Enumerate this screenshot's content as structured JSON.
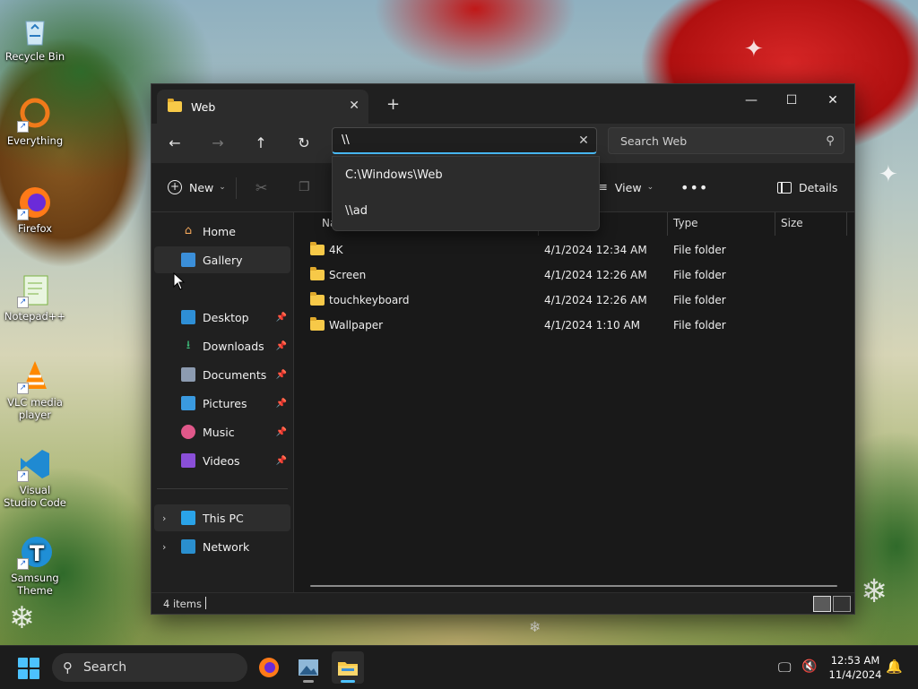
{
  "desktop": {
    "icons": [
      {
        "label": "Recycle Bin",
        "icon": "recycle-bin-icon"
      },
      {
        "label": "Everything",
        "icon": "everything-icon"
      },
      {
        "label": "Firefox",
        "icon": "firefox-icon"
      },
      {
        "label": "Notepad++",
        "icon": "notepad-plus-plus-icon"
      },
      {
        "label": "VLC media player",
        "icon": "vlc-icon"
      },
      {
        "label": "Visual Studio Code",
        "icon": "vscode-icon"
      },
      {
        "label": "Samsung Theme",
        "icon": "samsung-theme-icon"
      }
    ]
  },
  "window": {
    "tab_title": "Web",
    "address_value": "\\\\",
    "search_placeholder": "Search Web",
    "suggestions": [
      "C:\\Windows\\Web",
      "\\\\ad"
    ],
    "toolbar": {
      "new_label": "New",
      "view_label": "View",
      "details_label": "Details"
    },
    "sidebar": {
      "top": [
        {
          "label": "Home",
          "icon": "home-icon"
        },
        {
          "label": "Gallery",
          "icon": "gallery-icon"
        }
      ],
      "pinned": [
        {
          "label": "Desktop",
          "icon": "desktop-icon"
        },
        {
          "label": "Downloads",
          "icon": "downloads-icon"
        },
        {
          "label": "Documents",
          "icon": "documents-icon"
        },
        {
          "label": "Pictures",
          "icon": "pictures-icon"
        },
        {
          "label": "Music",
          "icon": "music-icon"
        },
        {
          "label": "Videos",
          "icon": "videos-icon"
        }
      ],
      "locations": [
        {
          "label": "This PC",
          "icon": "this-pc-icon"
        },
        {
          "label": "Network",
          "icon": "network-icon"
        }
      ]
    },
    "columns": {
      "name": "Na",
      "date": "ed",
      "type": "Type",
      "size": "Size"
    },
    "files": [
      {
        "name": "4K",
        "date": "4/1/2024 12:34 AM",
        "type": "File folder"
      },
      {
        "name": "Screen",
        "date": "4/1/2024 12:26 AM",
        "type": "File folder"
      },
      {
        "name": "touchkeyboard",
        "date": "4/1/2024 12:26 AM",
        "type": "File folder"
      },
      {
        "name": "Wallpaper",
        "date": "4/1/2024 1:10 AM",
        "type": "File folder"
      }
    ],
    "status": {
      "item_count": "4 items"
    }
  },
  "taskbar": {
    "search_placeholder": "Search",
    "time": "12:53 AM",
    "date": "11/4/2024"
  },
  "colors": {
    "accent": "#4cc2ff",
    "window_bg": "#202020",
    "content_bg": "#191919",
    "folder": "#f7c948"
  }
}
